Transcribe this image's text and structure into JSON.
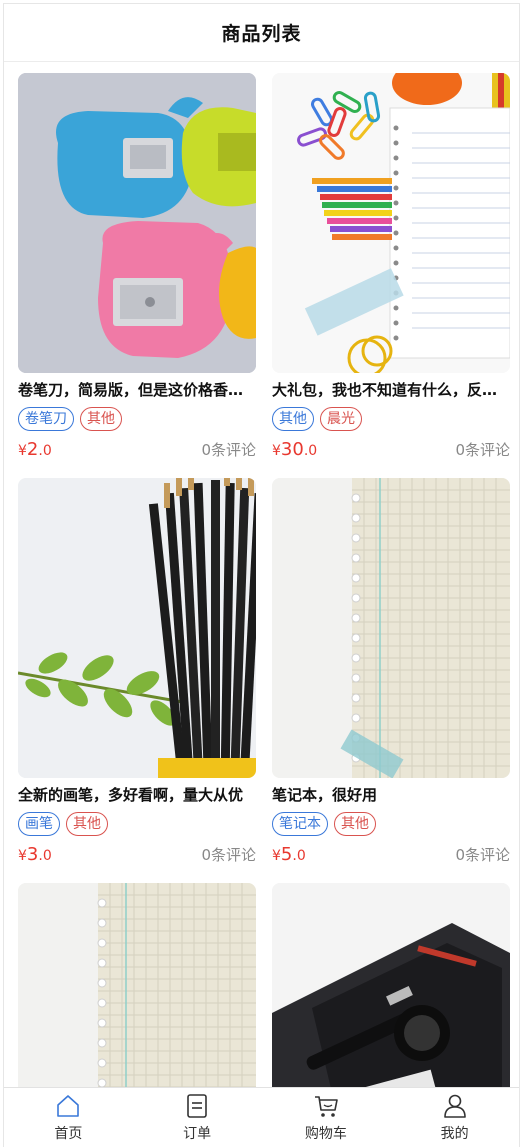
{
  "header": {
    "title": "商品列表"
  },
  "products": [
    {
      "title": "卷笔刀，简易版，但是这价格香不香",
      "tags": [
        "卷笔刀",
        "其他"
      ],
      "price_int": "2",
      "price_dec": ".0",
      "currency": "¥",
      "comments": "0条评论"
    },
    {
      "title": "大礼包，我也不知道有什么，反正很多",
      "tags": [
        "其他",
        "晨光"
      ],
      "price_int": "30",
      "price_dec": ".0",
      "currency": "¥",
      "comments": "0条评论"
    },
    {
      "title": "全新的画笔，多好看啊，量大从优",
      "tags": [
        "画笔",
        "其他"
      ],
      "price_int": "3",
      "price_dec": ".0",
      "currency": "¥",
      "comments": "0条评论"
    },
    {
      "title": "笔记本，很好用",
      "tags": [
        "笔记本",
        "其他"
      ],
      "price_int": "5",
      "price_dec": ".0",
      "currency": "¥",
      "comments": "0条评论"
    }
  ],
  "tabbar": {
    "items": [
      {
        "label": "首页",
        "icon": "home-icon",
        "active": true
      },
      {
        "label": "订单",
        "icon": "order-icon",
        "active": false
      },
      {
        "label": "购物车",
        "icon": "cart-icon",
        "active": false
      },
      {
        "label": "我的",
        "icon": "user-icon",
        "active": false
      }
    ]
  },
  "colors": {
    "accent": "#3a78d9",
    "price": "#e8382f",
    "tag_blue": "#3a78d9",
    "tag_red": "#d9534f"
  }
}
